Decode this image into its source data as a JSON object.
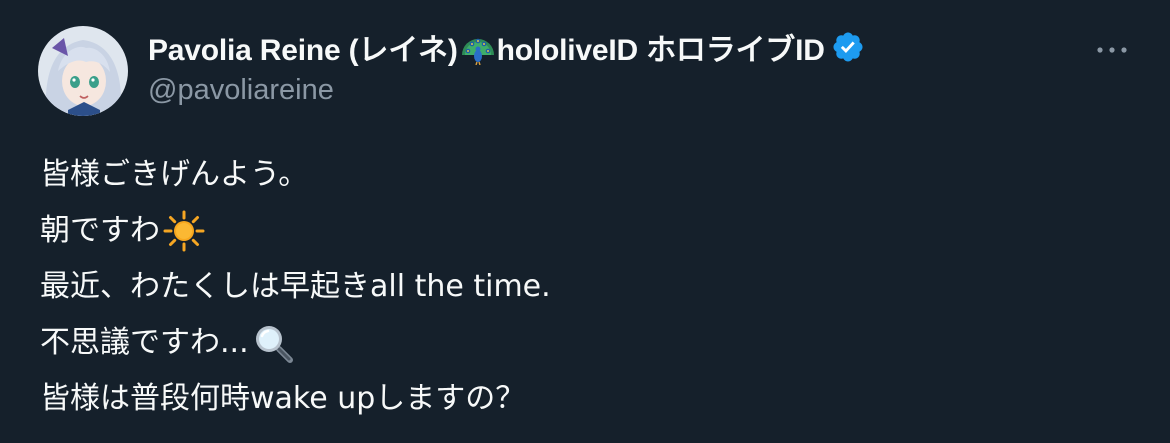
{
  "author": {
    "display_name": "Pavolia Reine (レイネ)",
    "name_suffix": "hololiveID ホロライブID",
    "handle": "@pavoliareine",
    "verified": true
  },
  "more_menu_label": "•••",
  "tweet": {
    "lines": [
      {
        "text": "皆様ごきげんよう。"
      },
      {
        "text": "朝ですわ",
        "emoji": "sun-emoji"
      },
      {
        "text": "最近、わたくしは早起きall the time."
      },
      {
        "text": "不思議ですわ...",
        "emoji": "magnifying-glass-emoji"
      },
      {
        "text": "皆様は普段何時wake upしますの？"
      }
    ]
  },
  "colors": {
    "background": "#15202b",
    "primary_text": "#f7f9f9",
    "secondary_text": "#8b98a5",
    "verified_blue": "#1d9bf0"
  }
}
